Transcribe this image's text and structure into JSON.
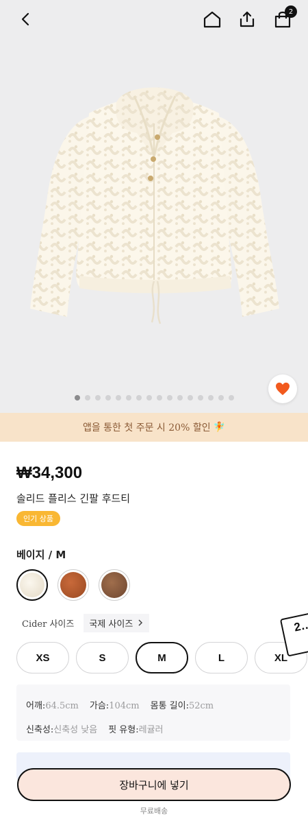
{
  "header": {
    "icons": [
      "chevron-left-icon",
      "home-icon",
      "share-icon",
      "shopping-bag-icon"
    ],
    "cart_count": "2"
  },
  "gallery": {
    "total_images": 16,
    "active_index": 0,
    "background": "#ededee"
  },
  "promo": {
    "text": "앱을 통한 첫 주문 시 20% 할인",
    "emoji": "🧚",
    "background": "#f8e3c9"
  },
  "product": {
    "price": "₩34,300",
    "name": "솔리드 플리스 긴팔 후드티",
    "tag": "인기 상품",
    "tag_color": "#f9b733"
  },
  "options": {
    "selected_label": "베이지 / M",
    "colors": [
      {
        "name": "beige",
        "hex": "#f0e9dc",
        "selected": true
      },
      {
        "name": "rust",
        "hex": "#b25a2d",
        "selected": false
      },
      {
        "name": "brown",
        "hex": "#8a5a3c",
        "selected": false
      }
    ],
    "size_tabs": [
      "Cider 사이즈",
      "국제 사이즈"
    ],
    "sizes": [
      "XS",
      "S",
      "M",
      "L",
      "XL"
    ],
    "selected_size": "M"
  },
  "coupon": {
    "text": "2…"
  },
  "measurements": {
    "row1": [
      {
        "key": "어깨:",
        "value": "64.5cm"
      },
      {
        "key": "가슴:",
        "value": "104cm"
      },
      {
        "key": "몸통 길이:",
        "value": "52cm"
      }
    ],
    "row2": [
      {
        "key": "신축성:",
        "value": "신축성 낮음"
      },
      {
        "key": "핏 유형:",
        "value": "레귤러"
      }
    ]
  },
  "footer": {
    "cart_button": "장바구니에 넣기",
    "shipping": "무료배송",
    "accent": "#fbe6dd"
  }
}
